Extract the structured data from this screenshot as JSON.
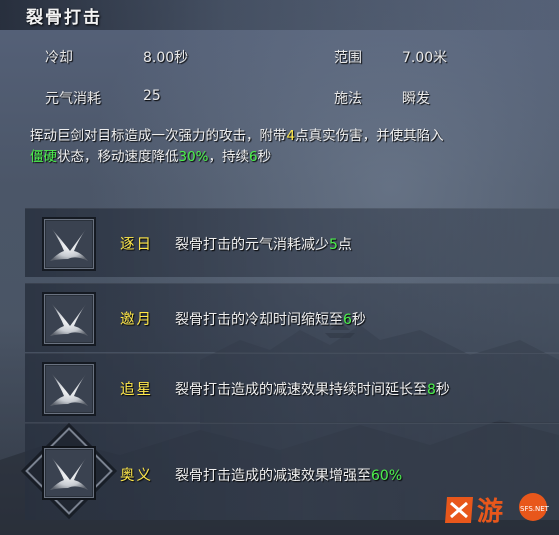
{
  "skill": {
    "name": "裂骨打击",
    "stats": {
      "cooldown_label": "冷却",
      "cooldown_value": "8.00秒",
      "range_label": "范围",
      "range_value": "7.00米",
      "cost_label": "元气消耗",
      "cost_value": "25",
      "cast_label": "施法",
      "cast_value": "瞬发"
    },
    "description": {
      "p1": "挥动巨剑对目标造成一次强力的攻击，附带",
      "n1": "4",
      "p2": "点真实伤害，并使其陷入",
      "status": "僵硬",
      "p3": "状态，移动速度降低",
      "slow": "30%",
      "p4": "，持续",
      "dur": "6",
      "p5": "秒"
    }
  },
  "talents": [
    {
      "name": "逐日",
      "text_a": "裂骨打击的元气消耗减少",
      "value": "5",
      "text_b": "点",
      "icon": "sword-slash-icon"
    },
    {
      "name": "邀月",
      "text_a": "裂骨打击的冷却时间缩短至",
      "value": "6",
      "text_b": "秒",
      "icon": "sword-slash-icon"
    },
    {
      "name": "追星",
      "text_a": "裂骨打击造成的减速效果持续时间延长至",
      "value": "8",
      "text_b": "秒",
      "icon": "sword-slash-icon"
    },
    {
      "name": "奥义",
      "text_a": "裂骨打击造成的减速效果增强至",
      "value": "60%",
      "text_b": "",
      "icon": "sword-slash-icon"
    }
  ],
  "watermark": {
    "text": "游",
    "sub": "SFS.NET"
  },
  "colors": {
    "highlight_yellow": "#ffe84a",
    "highlight_green": "#4cf04c"
  }
}
